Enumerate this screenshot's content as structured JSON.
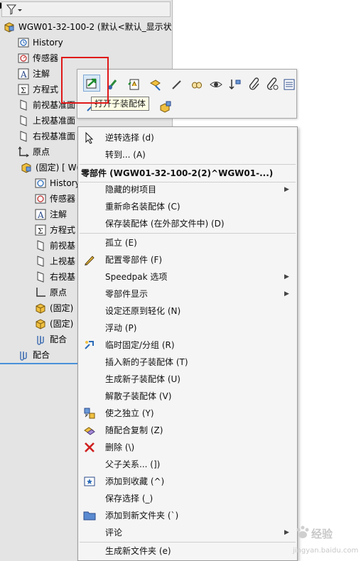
{
  "tree": {
    "root_label": "WGW01-32-100-2 (默认<默认_显示状",
    "items": [
      {
        "label": "History"
      },
      {
        "label": "传感器"
      },
      {
        "label": "注解"
      },
      {
        "label": "方程式"
      },
      {
        "label": "前视基准面"
      },
      {
        "label": "上视基准面"
      },
      {
        "label": "右视基准面"
      },
      {
        "label": "原点"
      },
      {
        "label": "(固定) [ W("
      },
      {
        "label": "History"
      },
      {
        "label": "传感器"
      },
      {
        "label": "注解"
      },
      {
        "label": "方程式"
      },
      {
        "label": "前视基"
      },
      {
        "label": "上视基"
      },
      {
        "label": "右视基"
      },
      {
        "label": "原点"
      },
      {
        "label": "(固定)"
      },
      {
        "label": "(固定)"
      },
      {
        "label": "配合"
      },
      {
        "label": "配合"
      }
    ]
  },
  "toolbar": {
    "tooltip": "打开子装配体"
  },
  "menu": {
    "items": [
      {
        "label": "逆转选择 (d)"
      },
      {
        "label": "转到... (A)"
      },
      {
        "label": "零部件 (WGW01-32-100-2(2)^WGW01-...)"
      },
      {
        "label": "隐藏的树项目"
      },
      {
        "label": "重新命名装配体 (C)"
      },
      {
        "label": "保存装配体 (在外部文件中) (D)"
      },
      {
        "label": "孤立 (E)"
      },
      {
        "label": "配置零部件 (F)"
      },
      {
        "label": "Speedpak 选项"
      },
      {
        "label": "零部件显示"
      },
      {
        "label": "设定还原到轻化 (N)"
      },
      {
        "label": "浮动 (P)"
      },
      {
        "label": "临时固定/分组 (R)"
      },
      {
        "label": "插入新的子装配体 (T)"
      },
      {
        "label": "生成新子装配体 (U)"
      },
      {
        "label": "解散子装配体 (V)"
      },
      {
        "label": "使之独立 (Y)"
      },
      {
        "label": "随配合复制 (Z)"
      },
      {
        "label": "删除 (\\)"
      },
      {
        "label": "父子关系... (])"
      },
      {
        "label": "添加到收藏 (^)"
      },
      {
        "label": "保存选择 (_)"
      },
      {
        "label": "添加到新文件夹 (`)"
      },
      {
        "label": "评论"
      },
      {
        "label": "生成新文件夹 (e)"
      }
    ]
  },
  "watermark": {
    "brand": "经验",
    "url": "jingyan.baidu.com"
  },
  "colors": {
    "highlight_box": "#e01818",
    "tree_bg": "#e4e4e4",
    "menu_bg": "#f5f5f5",
    "tooltip_bg": "#ffffe6"
  }
}
